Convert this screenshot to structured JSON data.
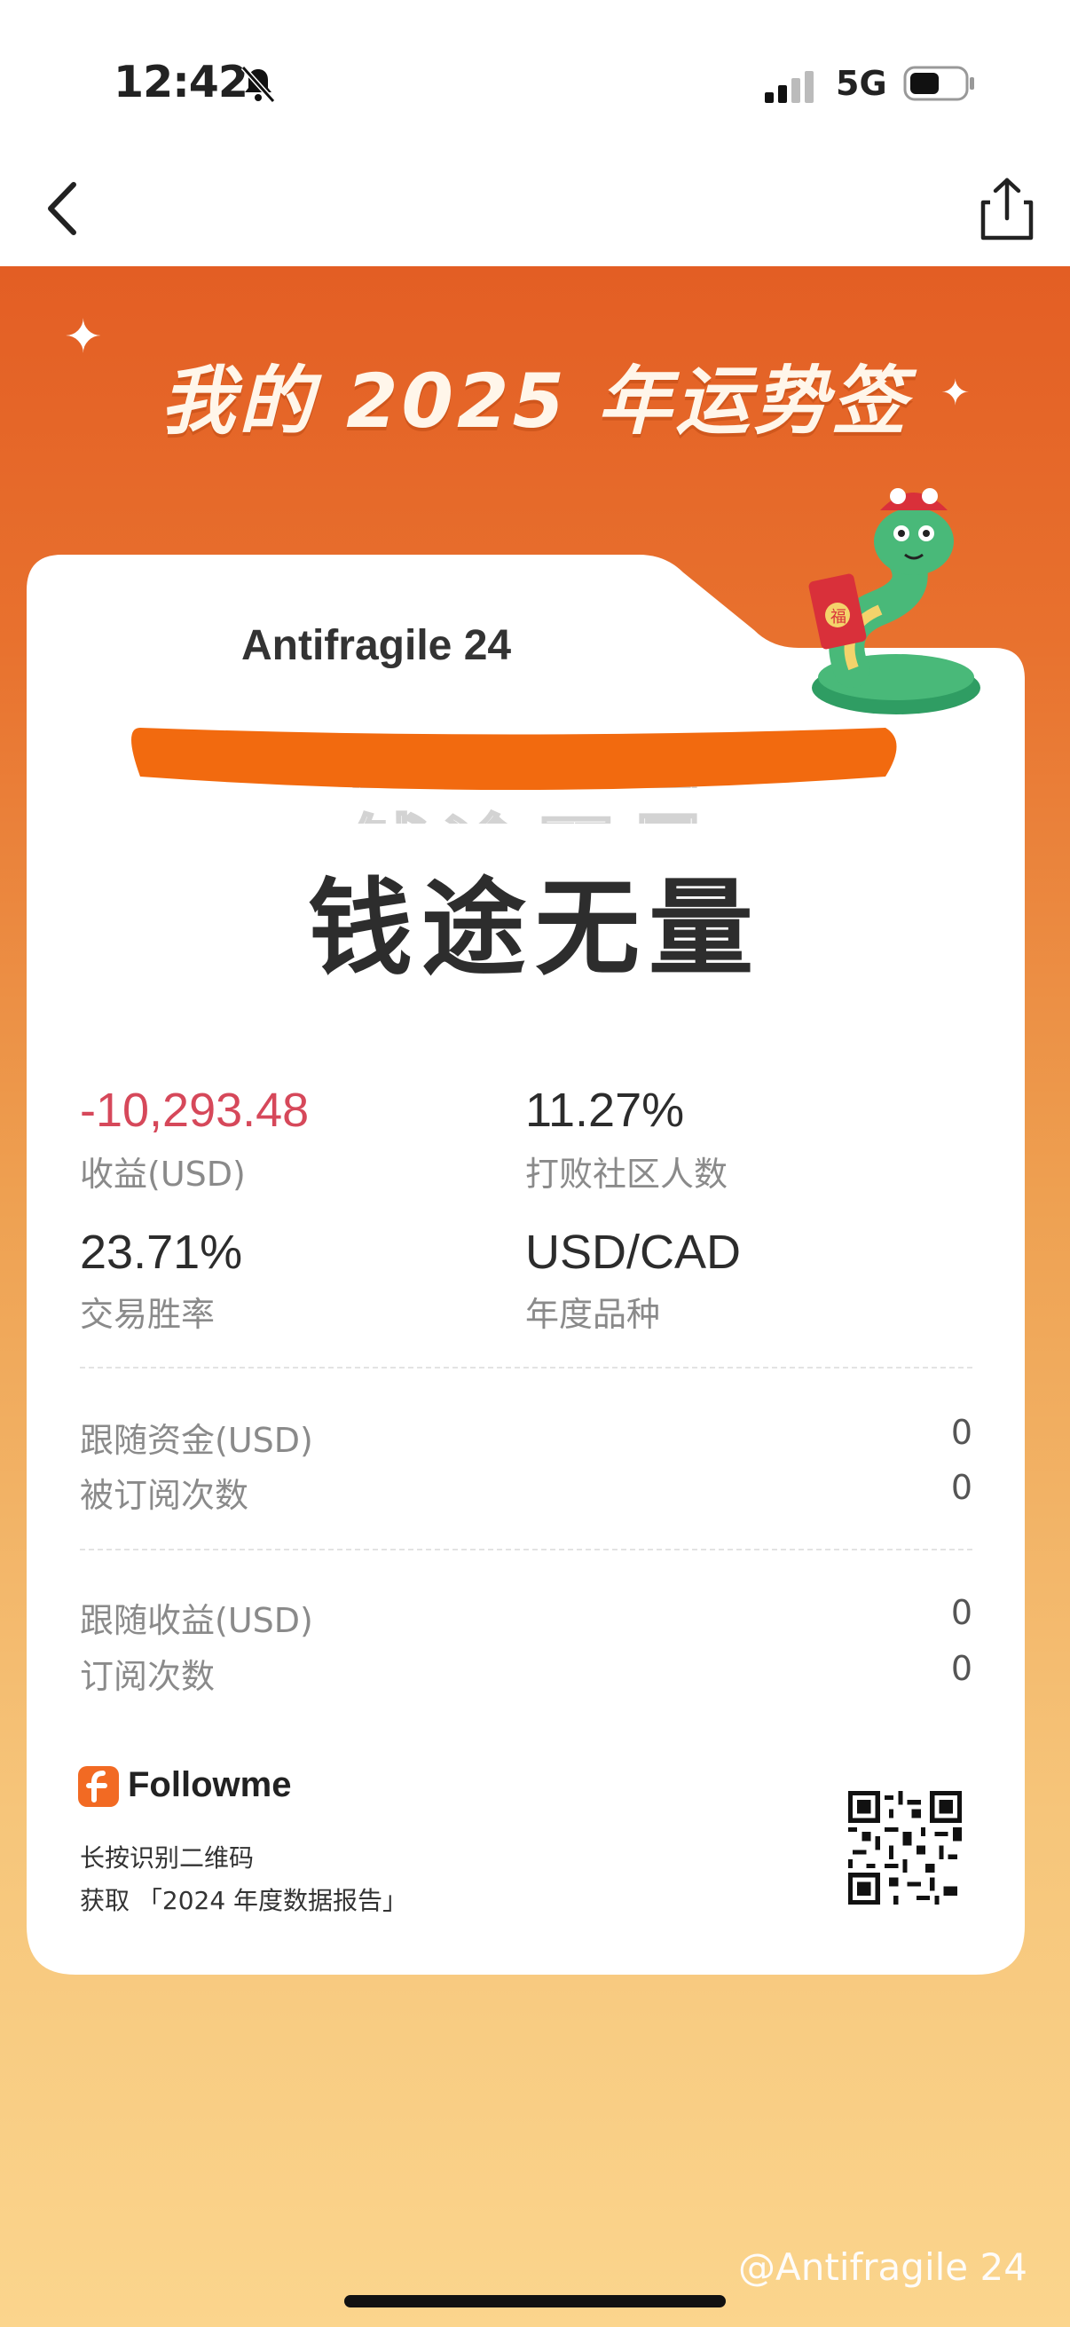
{
  "status_bar": {
    "time": "12:42",
    "network": "5G"
  },
  "nav": {
    "back_icon": "chevron-left-icon",
    "share_icon": "share-icon"
  },
  "poster": {
    "title": "我的 2025 年运势签",
    "user": "Antifragile 24",
    "slogan": "钱途无量",
    "stats": [
      {
        "value": "-10,293.48",
        "label": "收益(USD)"
      },
      {
        "value": "11.27%",
        "label": "打败社区人数"
      },
      {
        "value": "23.71%",
        "label": "交易胜率"
      },
      {
        "value": "USD/CAD",
        "label": "年度品种"
      }
    ],
    "follow_rows": [
      {
        "label": "跟随资金(USD)",
        "value": "0"
      },
      {
        "label": "被订阅次数",
        "value": "0"
      }
    ],
    "subscribe_rows": [
      {
        "label": "跟随收益(USD)",
        "value": "0"
      },
      {
        "label": "订阅次数",
        "value": "0"
      }
    ],
    "brand": "Followme",
    "hint_line1": "长按识别二维码",
    "hint_line2": "获取 「2024 年度数据报告」"
  },
  "watermark": "@Antifragile 24",
  "colors": {
    "accent": "#e35e24",
    "negative": "#d6485a",
    "slogan_bar": "#f26a0f"
  }
}
